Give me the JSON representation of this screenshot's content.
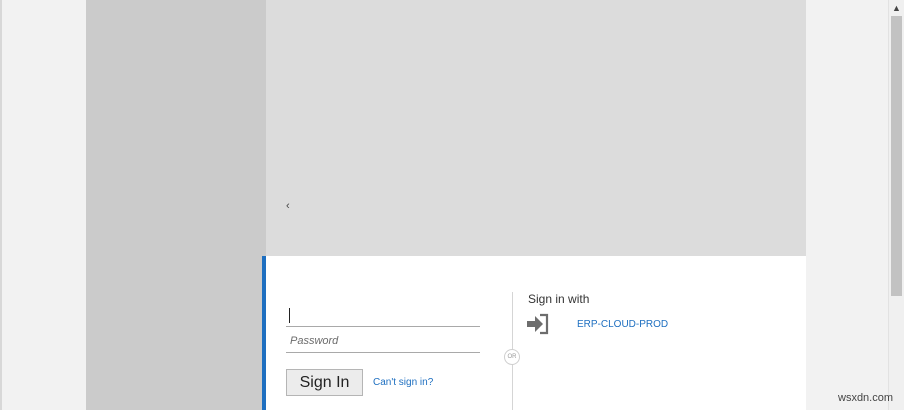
{
  "banner": {
    "glyph": "‹"
  },
  "login": {
    "username_value": "",
    "password_placeholder": "Password",
    "signin_button": "Sign In",
    "cant_signin_link": "Can't sign in?",
    "or_label": "OR"
  },
  "federated": {
    "heading": "Sign in with",
    "provider_icon": "sign-in-arrow-icon",
    "provider_name": "ERP-CLOUD-PROD"
  },
  "scrollbar": {
    "up_icon": "▲"
  },
  "watermark": "wsxdn.com",
  "colors": {
    "accent": "#1e6fc0",
    "banner": "#dcdcdc",
    "side_panel": "#cbcbcb"
  }
}
